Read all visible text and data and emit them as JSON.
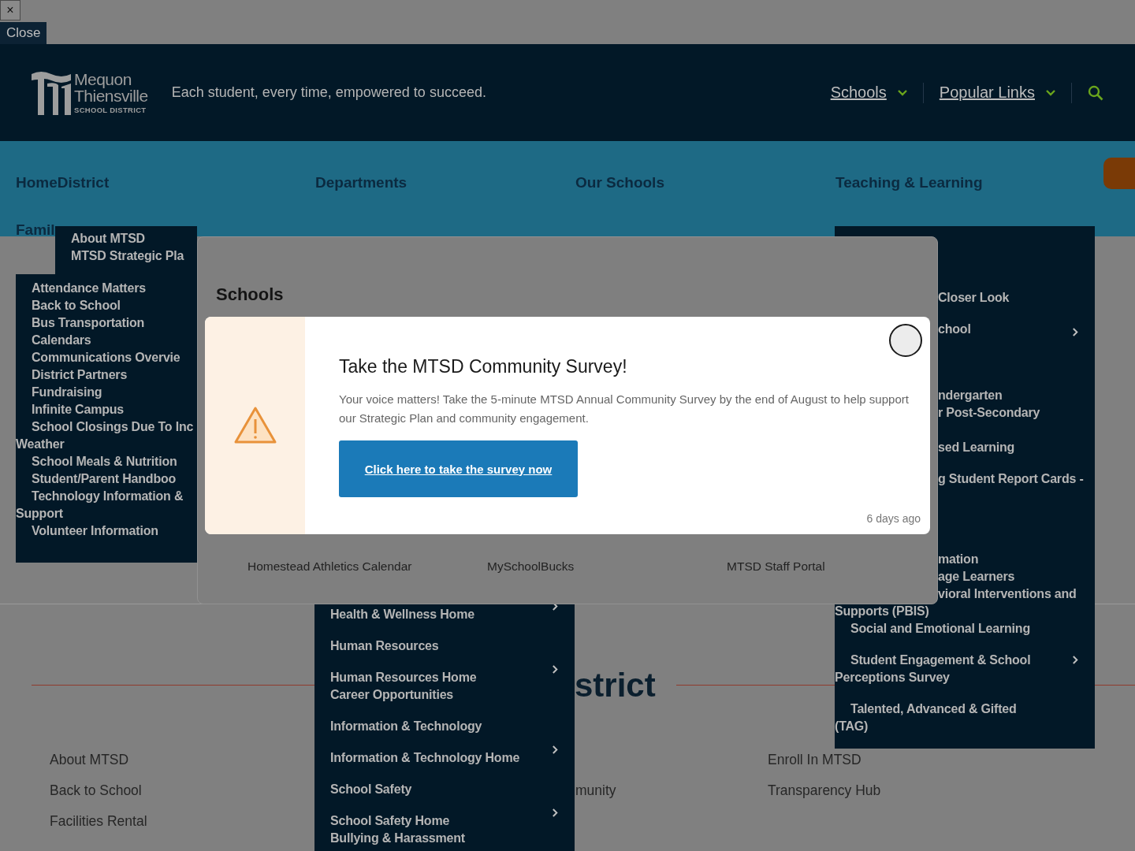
{
  "top_bar": {
    "close_icon": "×",
    "close_button": "Close"
  },
  "header": {
    "logo": {
      "name_line_1": "Mequon",
      "name_line_2": "Thiensville",
      "subtitle": "SCHOOL DISTRICT"
    },
    "tagline": "Each student, every time, empowered to succeed.",
    "links": [
      {
        "label": "Schools",
        "dropdown": true
      },
      {
        "label": "Popular Links",
        "dropdown": true
      }
    ]
  },
  "main_nav": {
    "items": [
      "HomeDistrict",
      "Departments",
      "Our Schools",
      "Teaching & Learning"
    ],
    "second_row": [
      "Famil"
    ]
  },
  "district_menu": {
    "items": [
      "About MTSD",
      "MTSD Strategic Pla"
    ]
  },
  "families_menu": {
    "items": [
      {
        "label": "Attendance Matters"
      },
      {
        "label": "Back to School"
      },
      {
        "label": "Bus Transportation"
      },
      {
        "label": "Calendars"
      },
      {
        "label": "Communications Overvie"
      },
      {
        "label": "District Partners"
      },
      {
        "label": "Fundraising"
      },
      {
        "label": "Infinite Campus"
      },
      {
        "label": "School Closings Due To Inc",
        "wrap": "Weather"
      },
      {
        "label": "School Meals & Nutrition"
      },
      {
        "label": "Student/Parent Handboo"
      },
      {
        "label": "Technology Information &",
        "wrap": "Support"
      },
      {
        "label": "Volunteer Information"
      }
    ]
  },
  "schools_panel": {
    "title": "Schools",
    "links": [
      "Homestead Athletics Calendar",
      "MySchoolBucks",
      "MTSD Staff Portal"
    ]
  },
  "survey_dialog": {
    "title": "Take the MTSD Community Survey!",
    "message": "Your voice matters! Take the 5-minute MTSD Annual Community Survey by the end of August to help support our Strategic Plan and community engagement.",
    "button": "Click here to take the survey now",
    "time": "6 days ago"
  },
  "programs_menu": {
    "top_items": [
      {
        "lines": [
          "Closer Look"
        ],
        "chevron": false
      },
      {
        "lines": [
          "chool"
        ],
        "chevron": true
      },
      {
        "lines": [
          "ndergarten",
          "r Post-Secondary"
        ],
        "chevron": false
      },
      {
        "lines": [
          "sed Learning"
        ],
        "chevron": false
      },
      {
        "lines": [
          "g Student Report Cards -"
        ],
        "chevron": false
      },
      {
        "lines": [
          "mation",
          "age Learners",
          "vioral Interventions and"
        ],
        "chevron": false
      }
    ],
    "lower_items": [
      {
        "lines": [
          "Supports (PBIS)"
        ],
        "chevron": false,
        "kind": "continuation"
      },
      {
        "lines": [
          "Social and Emotional Learning"
        ],
        "chevron": false,
        "kind": "item"
      },
      {
        "lines": [
          "Student Engagement & School",
          "Perceptions Survey"
        ],
        "chevron": true,
        "kind": "item"
      },
      {
        "lines": [
          "Talented, Advanced & Gifted",
          "(TAG)"
        ],
        "chevron": false,
        "kind": "item"
      }
    ]
  },
  "departments_menu": {
    "items": [
      {
        "lines": [
          "Health & Wellness Home"
        ],
        "chevron": true
      },
      {
        "lines": [
          "Human Resources"
        ],
        "chevron": false
      },
      {
        "lines": [
          "Human Resources Home",
          "Career Opportunities"
        ],
        "chevron": true
      },
      {
        "lines": [
          "Information & Technology"
        ],
        "chevron": false
      },
      {
        "lines": [
          "Information & Technology Home"
        ],
        "chevron": true
      },
      {
        "lines": [
          "School Safety"
        ],
        "chevron": false
      },
      {
        "lines": [
          "School Safety Home",
          "Bullying & Harassment"
        ],
        "chevron": true
      }
    ]
  },
  "page": {
    "heading": "strict",
    "footer_columns": [
      [
        "About MTSD",
        "Back to School",
        "Facilities Rental"
      ],
      [
        "munity"
      ],
      [
        "Enroll In MTSD",
        "Transparency Hub"
      ]
    ]
  }
}
